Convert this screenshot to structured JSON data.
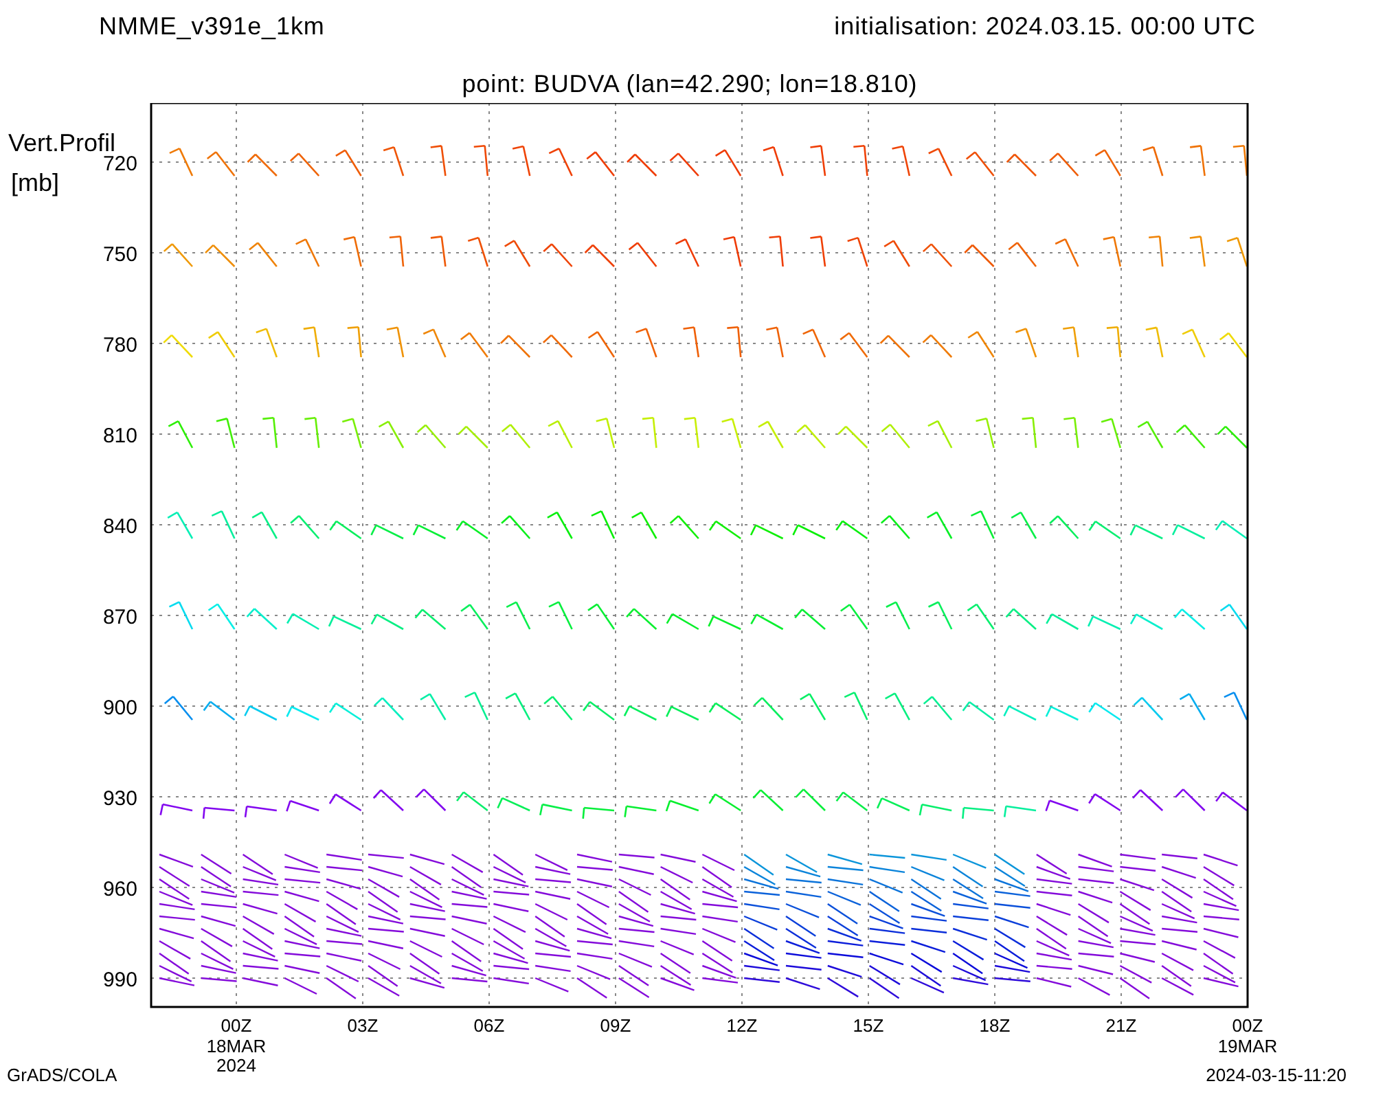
{
  "header": {
    "model": "NMME_v391e_1km",
    "initialisation": "initialisation: 2024.03.15. 00:00 UTC",
    "point": "point: BUDVA (lan=42.290; lon=18.810)"
  },
  "y_axis": {
    "title": [
      "Vert.Profil",
      "[mb]"
    ],
    "ticks": [
      "720",
      "750",
      "780",
      "810",
      "840",
      "870",
      "900",
      "930",
      "960",
      "990"
    ]
  },
  "x_axis": {
    "ticks": [
      {
        "label": "00Z",
        "sub": [
          "18MAR",
          "2024"
        ]
      },
      {
        "label": "03Z"
      },
      {
        "label": "06Z"
      },
      {
        "label": "09Z"
      },
      {
        "label": "12Z"
      },
      {
        "label": "15Z"
      },
      {
        "label": "18Z"
      },
      {
        "label": "21Z"
      },
      {
        "label": "00Z",
        "sub": [
          "19MAR"
        ]
      }
    ]
  },
  "footer": {
    "left": "GrADS/COLA",
    "right": "2024-03-15-11:20"
  }
}
